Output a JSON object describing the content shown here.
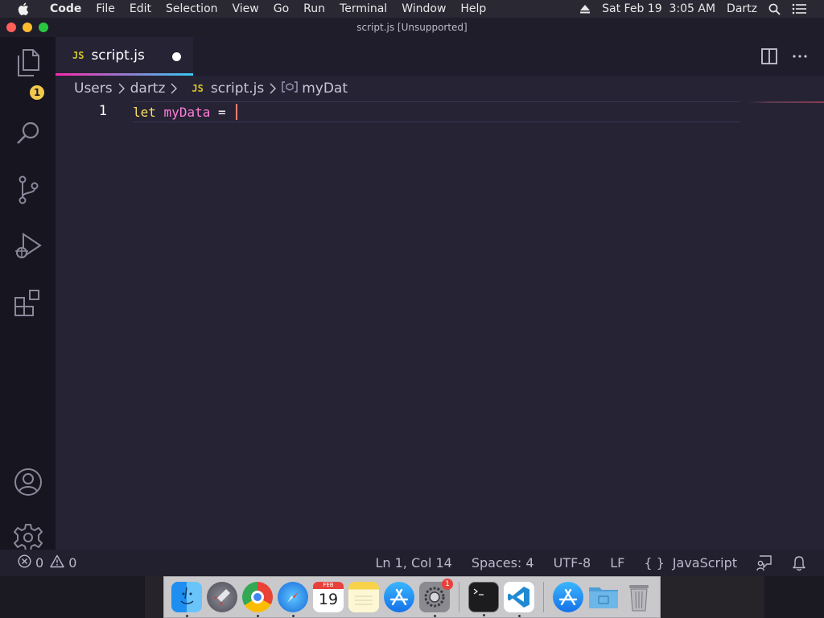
{
  "menubar": {
    "app_name": "Code",
    "items": [
      "File",
      "Edit",
      "Selection",
      "View",
      "Go",
      "Run",
      "Terminal",
      "Window",
      "Help"
    ],
    "datetime": "Sat Feb 19  3:05 AM",
    "user": "Dartz"
  },
  "window": {
    "title": "script.js [Unsupported]"
  },
  "activity_bar": {
    "explorer_badge": "1",
    "items": [
      "explorer-icon",
      "search-icon",
      "source-control-icon",
      "run-debug-icon",
      "extensions-icon",
      "account-icon",
      "manage-gear-icon"
    ]
  },
  "tab": {
    "lang_badge": "JS",
    "name": "script.js",
    "dirty": true
  },
  "breadcrumb": {
    "parts": [
      "Users",
      "dartz",
      "script.js",
      "myDat"
    ],
    "lang_badge": "JS",
    "symbol_icon": "[⊘]"
  },
  "editor": {
    "line_number": "1",
    "keyword": "let",
    "variable": "myData",
    "operator": "="
  },
  "statusbar": {
    "errors": "0",
    "warnings": "0",
    "position": "Ln 1, Col 14",
    "indent": "Spaces: 4",
    "encoding": "UTF-8",
    "eol": "LF",
    "language_braces": "{ }",
    "language": "JavaScript"
  },
  "dock": {
    "calendar_month": "FEB",
    "calendar_day": "19",
    "prefs_badge": "1",
    "apps": [
      "finder-icon",
      "launchpad-icon",
      "chrome-icon",
      "safari-icon",
      "calendar-icon",
      "notes-icon",
      "app-store-icon",
      "system-preferences-icon",
      "terminal-icon",
      "vscode-icon",
      "app-store-downloads-icon",
      "folder-icon",
      "trash-icon"
    ]
  },
  "colors": {
    "keyword": "#fede5d",
    "variable": "#ff7edb",
    "cursor": "#f97e72",
    "badge": "#f2c94c",
    "tab_gradient_start": "#f92aad",
    "tab_gradient_end": "#36c8f1"
  }
}
